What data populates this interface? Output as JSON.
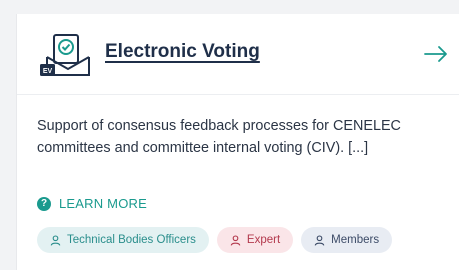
{
  "card": {
    "icon_badge": "EV",
    "icon": "ev-vote-document-icon",
    "title": "Electronic Voting",
    "arrow_icon": "arrow-right-icon",
    "description": "Support of consensus feedback processes for CENELEC committees and committee internal voting (CIV). [...]",
    "learn_more": {
      "icon": "question-circle-icon",
      "icon_glyph": "?",
      "label": "LEARN MORE"
    },
    "tags": [
      {
        "label": "Technical Bodies Officers",
        "icon": "user-icon"
      },
      {
        "label": "Expert",
        "icon": "user-icon"
      },
      {
        "label": "Members",
        "icon": "user-icon"
      }
    ]
  },
  "colors": {
    "accent_teal": "#1a9a8e",
    "title_navy": "#1f2f49",
    "tag_expert": "#b3394d"
  }
}
